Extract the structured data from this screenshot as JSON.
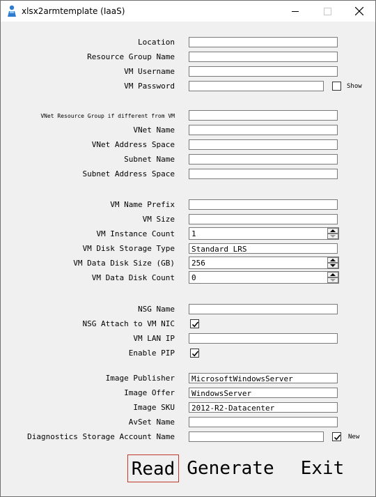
{
  "window": {
    "title": "xlsx2armtemplate (IaaS)"
  },
  "labels": {
    "location": "Location",
    "resource_group_name": "Resource Group Name",
    "vm_username": "VM Username",
    "vm_password": "VM Password",
    "vnet_rg": "VNet Resource Group if different from VM",
    "vnet_name": "VNet Name",
    "vnet_address_space": "VNet Address Space",
    "subnet_name": "Subnet Name",
    "subnet_address_space": "Subnet Address Space",
    "vm_name_prefix": "VM Name Prefix",
    "vm_size": "VM Size",
    "vm_instance_count": "VM Instance Count",
    "vm_disk_storage_type": "VM Disk Storage Type",
    "vm_data_disk_size": "VM Data Disk Size (GB)",
    "vm_data_disk_count": "VM Data Disk Count",
    "nsg_name": "NSG Name",
    "nsg_attach": "NSG Attach to VM NIC",
    "vm_lan_ip": "VM LAN IP",
    "enable_pip": "Enable PIP",
    "image_publisher": "Image Publisher",
    "image_offer": "Image Offer",
    "image_sku": "Image SKU",
    "avset_name": "AvSet Name",
    "diag_storage": "Diagnostics Storage Account Name"
  },
  "values": {
    "location": "",
    "resource_group_name": "",
    "vm_username": "",
    "vm_password": "",
    "vnet_rg": "",
    "vnet_name": "",
    "vnet_address_space": "",
    "subnet_name": "",
    "subnet_address_space": "",
    "vm_name_prefix": "",
    "vm_size": "",
    "vm_instance_count": "1",
    "vm_disk_storage_type": "Standard_LRS",
    "vm_data_disk_size": "256",
    "vm_data_disk_count": "0",
    "nsg_name": "",
    "vm_lan_ip": "",
    "image_publisher": "MicrosoftWindowsServer",
    "image_offer": "WindowsServer",
    "image_sku": "2012-R2-Datacenter",
    "avset_name": "",
    "diag_storage": ""
  },
  "checkboxes": {
    "show_password": {
      "label": "Show",
      "checked": false
    },
    "nsg_attach": {
      "checked": true
    },
    "enable_pip": {
      "checked": true
    },
    "diag_new": {
      "label": "New",
      "checked": true
    }
  },
  "buttons": {
    "read": "Read",
    "generate": "Generate",
    "exit": "Exit"
  }
}
